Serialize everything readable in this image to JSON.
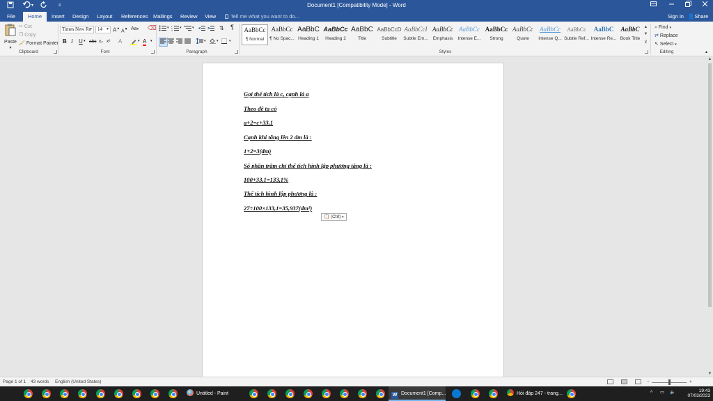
{
  "titlebar": {
    "title": "Document1 [Compatibility Mode] - Word",
    "save_icon": "save-icon",
    "undo_icon": "undo-icon",
    "redo_icon": "redo-icon",
    "customize_icon": "customize-qat-icon",
    "ribbon_options_icon": "ribbon-display-options-icon",
    "minimize_icon": "minimize-icon",
    "restore_icon": "restore-icon",
    "close_icon": "close-icon"
  },
  "tabs": {
    "items": [
      "File",
      "Home",
      "Insert",
      "Design",
      "Layout",
      "References",
      "Mailings",
      "Review",
      "View"
    ],
    "active": "Home",
    "tell_me": "Tell me what you want to do...",
    "sign_in": "Sign in",
    "share": "Share"
  },
  "clipboard": {
    "paste": "Paste",
    "cut": "Cut",
    "copy": "Copy",
    "format_painter": "Format Painter",
    "label": "Clipboard"
  },
  "font": {
    "name": "Times New Ro",
    "size": "14",
    "label": "Font",
    "bold": "B",
    "italic": "I",
    "underline": "U",
    "strike": "abc",
    "subscript": "x₂",
    "superscript": "x²",
    "grow": "A",
    "shrink": "A",
    "change_case": "Aa",
    "highlight_color": "#ffff00",
    "font_color": "#ff0000"
  },
  "paragraph": {
    "label": "Paragraph",
    "pilcrow": "¶"
  },
  "styles": {
    "label": "Styles",
    "items": [
      {
        "preview": "AaBbCc",
        "name": "¶ Normal"
      },
      {
        "preview": "AaBbCc",
        "name": "¶ No Spac..."
      },
      {
        "preview": "AaBbC",
        "name": "Heading 1"
      },
      {
        "preview": "AaBbCc",
        "name": "Heading 2"
      },
      {
        "preview": "AaBbC",
        "name": "Title"
      },
      {
        "preview": "AaBbCcD",
        "name": "Subtitle"
      },
      {
        "preview": "AaBbCcI",
        "name": "Subtle Em..."
      },
      {
        "preview": "AaBbCc",
        "name": "Emphasis"
      },
      {
        "preview": "AaBbCc",
        "name": "Intense E..."
      },
      {
        "preview": "AaBbCc",
        "name": "Strong"
      },
      {
        "preview": "AaBbCc",
        "name": "Quote"
      },
      {
        "preview": "AaBbCc",
        "name": "Intense Q..."
      },
      {
        "preview": "AaBbCc",
        "name": "Subtle Ref..."
      },
      {
        "preview": "AaBbC",
        "name": "Intense Re..."
      },
      {
        "preview": "AaBbC",
        "name": "Book Title"
      }
    ]
  },
  "editing": {
    "label": "Editing",
    "find": "Find",
    "replace": "Replace",
    "select": "Select"
  },
  "document": {
    "paragraphs": [
      "Gọi thể tích là c, cạnh là a",
      "Theo đề ta có",
      "a+2=c+33,1",
      "Cạnh khi tăng lên 2 dm là :",
      "1+2=3(dm)",
      "Số phần trăm chỉ thể tích hình lập phương tăng là :",
      "100+33,1=133,1%",
      "Thể tích hình lập phương là :",
      "27÷100×133,1=35,937(dm³)"
    ],
    "paste_options": "(Ctrl)"
  },
  "statusbar": {
    "page": "Page 1 of 1",
    "words": "43 words",
    "language": "English (United States)",
    "zoom_minus": "−",
    "zoom_plus": "+"
  },
  "taskbar": {
    "apps": [
      {
        "label": "Untitled - Paint",
        "icon": "paint-icon"
      },
      {
        "label": "Document1 [Comp...",
        "icon": "word-icon",
        "active": true
      },
      {
        "label": "Hỏi đáp 247 - trang...",
        "icon": "chrome-icon"
      }
    ],
    "clock_time": "19:43",
    "clock_date": "07/03/2023"
  },
  "colors": {
    "word_blue": "#2b579a",
    "ribbon_bg": "#f3f3f3",
    "canvas_bg": "#e6e6e6",
    "taskbar_bg": "#1f1f1f"
  }
}
